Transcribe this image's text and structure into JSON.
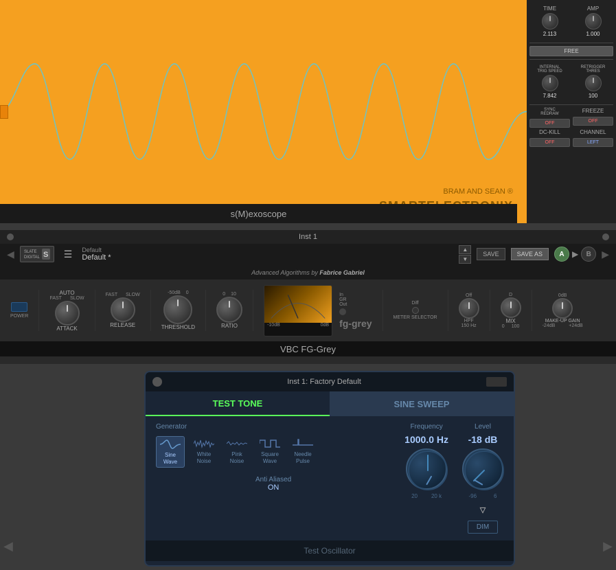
{
  "oscilloscope": {
    "title": "s(M)exoscope",
    "brand_line1": "BRAM AND SEAN ®",
    "brand_line2": "SMARTELECTRONIX",
    "sidebar": {
      "time_label": "TIME",
      "time_value": "2.113",
      "amp_label": "AMP",
      "amp_value": "1.000",
      "free_label": "FREE",
      "internal_trig_label": "INTERNAL\nTRIG SPEED",
      "internal_trig_value": "7.842",
      "retrigger_label": "RETRIGGER\nTHRES",
      "retrigger_value": "100",
      "sync_redraw_label": "SYNC\nREDRAW",
      "sync_redraw_value": "OFF",
      "freeze_label": "FREEZE",
      "freeze_value": "OFF",
      "dc_kill_label": "DC-KILL",
      "dc_kill_value": "OFF",
      "channel_label": "CHANNEL",
      "channel_value": "LEFT"
    }
  },
  "nav": {
    "inst_label": "Inst 1"
  },
  "vbc": {
    "title": "VBC FG-Grey",
    "preset_category": "Default",
    "preset_name": "Default *",
    "save_label": "SAVE",
    "save_as_label": "SAVE AS",
    "ab_a": "A",
    "ab_b": "B",
    "algorithm_label": "Advanced Algorithms by Fabrice Gabriel",
    "power_label": "POWER",
    "attack": {
      "fast_label": "FAST",
      "slow_label": "SLOW",
      "attack_label": "ATTACK",
      "auto_label": "AUTO"
    },
    "threshold": {
      "label": "THRESHOLD",
      "scale_low": "-50dB",
      "scale_high": "0"
    },
    "ratio": {
      "label": "RATIO",
      "scale_low": "0",
      "scale_high": "10"
    },
    "release": {
      "fast_label": "FAST",
      "slow_label": "SLOW",
      "release_label": "RELEASE"
    },
    "vu_meter": {
      "low": "-10dB",
      "high": "0dB"
    },
    "fg_grey_label": "fg-grey",
    "meter_selector_label": "METER SELECTOR",
    "hpf_label": "HPF",
    "hpf_value": "150 Hz",
    "mix_label": "MIX",
    "mix_scale_low": "0",
    "mix_scale_high": "100",
    "makeup_label": "MAKE-UP GAIN",
    "makeup_scale_low": "-24dB",
    "makeup_scale_high": "+24dB",
    "in_label": "In",
    "gr_label": "GR",
    "out_label": "Out",
    "diff_label": "Diff",
    "hpf_off": "Off",
    "hpf_db": "0dB"
  },
  "test_osc": {
    "title": "Inst 1: Factory Default",
    "tab_test_tone": "TEST TONE",
    "tab_sine_sweep": "SINE SWEEP",
    "generator_label": "Generator",
    "waveforms": [
      {
        "icon": "sine",
        "label": "Sine\nWave",
        "selected": true
      },
      {
        "icon": "white",
        "label": "White\nNoise",
        "selected": false
      },
      {
        "icon": "pink",
        "label": "Pink\nNoise",
        "selected": false
      },
      {
        "icon": "square",
        "label": "Square\nWave",
        "selected": false
      },
      {
        "icon": "needle",
        "label": "Needle\nPulse",
        "selected": false
      }
    ],
    "anti_aliased_label": "Anti Aliased",
    "anti_aliased_value": "ON",
    "frequency_label": "Frequency",
    "frequency_value": "1000.0 Hz",
    "freq_range_low": "20",
    "freq_range_high": "20 k",
    "level_label": "Level",
    "level_value": "-18 dB",
    "level_range_low": "-96",
    "level_range_high": "6",
    "dim_label": "DIM",
    "footer_label": "Test Oscillator"
  }
}
